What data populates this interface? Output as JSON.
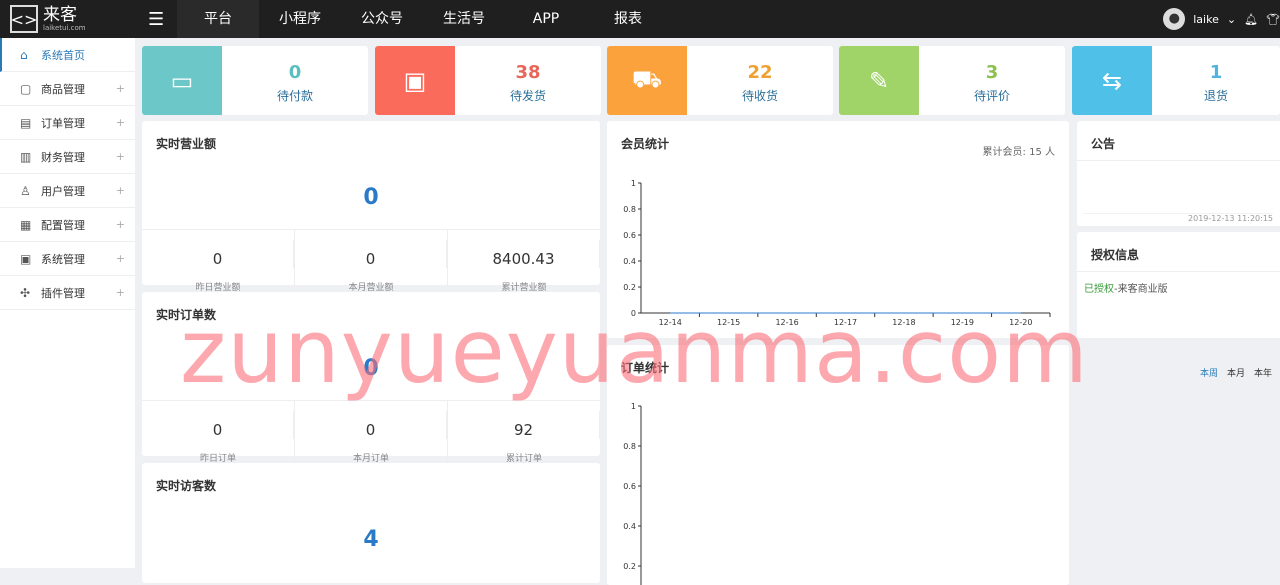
{
  "header": {
    "logo_icon": "bracket-logo-icon",
    "brand": "来客",
    "brand_sub": "laiketui.com",
    "nav": [
      "平台",
      "小程序",
      "公众号",
      "生活号",
      "APP",
      "报表"
    ],
    "user": "laike"
  },
  "sidebar": {
    "items": [
      {
        "label": "系统首页",
        "icon": "home-icon"
      },
      {
        "label": "商品管理",
        "icon": "bag-icon"
      },
      {
        "label": "订单管理",
        "icon": "clipboard-icon"
      },
      {
        "label": "财务管理",
        "icon": "ledger-icon"
      },
      {
        "label": "用户管理",
        "icon": "user-icon"
      },
      {
        "label": "配置管理",
        "icon": "config-icon"
      },
      {
        "label": "系统管理",
        "icon": "monitor-icon"
      },
      {
        "label": "插件管理",
        "icon": "puzzle-icon"
      }
    ]
  },
  "stats": [
    {
      "value": "0",
      "label": "待付款",
      "color": "#6cc8c8",
      "num_color": "#5bbfbf"
    },
    {
      "value": "38",
      "label": "待发货",
      "color": "#fb6b5b",
      "num_color": "#e8675a"
    },
    {
      "value": "22",
      "label": "待收货",
      "color": "#fba23d",
      "num_color": "#f0a030"
    },
    {
      "value": "3",
      "label": "待评价",
      "color": "#a0d468",
      "num_color": "#8cc152"
    },
    {
      "value": "1",
      "label": "退货",
      "color": "#4fc1e9",
      "num_color": "#4fb5e0"
    }
  ],
  "revenue": {
    "title": "实时营业额",
    "value": "0",
    "subs": [
      {
        "v": "0",
        "l": "昨日营业额"
      },
      {
        "v": "0",
        "l": "本月营业额"
      },
      {
        "v": "8400.43",
        "l": "累计营业额"
      }
    ]
  },
  "orders": {
    "title": "实时订单数",
    "value": "0",
    "subs": [
      {
        "v": "0",
        "l": "昨日订单"
      },
      {
        "v": "0",
        "l": "本月订单"
      },
      {
        "v": "92",
        "l": "累计订单"
      }
    ]
  },
  "visitors": {
    "title": "实时访客数",
    "value": "4"
  },
  "member": {
    "title": "会员统计",
    "total": "累计会员: 15 人"
  },
  "order_stats": {
    "title": "订单统计",
    "tabs": [
      "本周",
      "本月",
      "本年"
    ]
  },
  "notice": {
    "title": "公告",
    "time": "2019-12-13 11:20:15"
  },
  "license": {
    "title": "授权信息",
    "status": "已授权",
    "edition": "-来客商业版"
  },
  "watermark": "zunyueyuanma.com",
  "chart_data": [
    {
      "type": "line",
      "title": "会员统计",
      "x": [
        "12-14",
        "12-15",
        "12-16",
        "12-17",
        "12-18",
        "12-19",
        "12-20"
      ],
      "values": [
        0,
        0,
        0,
        0,
        0,
        0,
        0
      ],
      "ylim": [
        0,
        1
      ],
      "yticks": [
        "0",
        "0.2",
        "0.4",
        "0.6",
        "0.8",
        "1"
      ]
    },
    {
      "type": "line",
      "title": "订单统计",
      "ylim": [
        0,
        1
      ],
      "yticks": [
        "0.2",
        "0.4",
        "0.6",
        "0.8",
        "1"
      ]
    }
  ]
}
